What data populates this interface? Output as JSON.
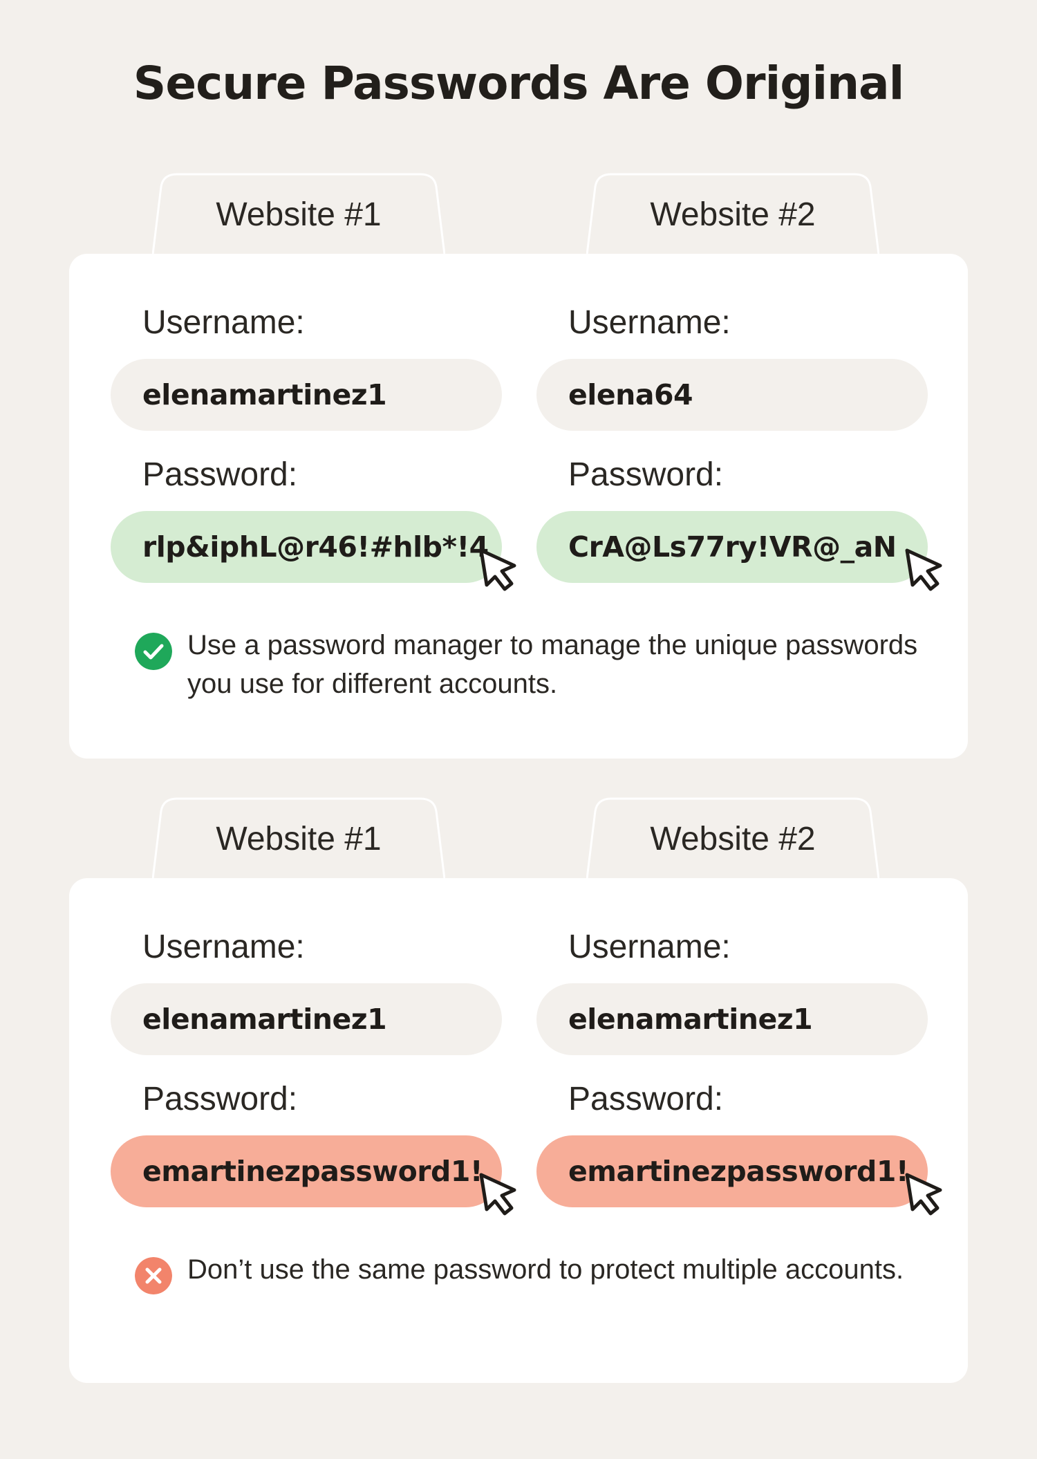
{
  "title": "Secure Passwords Are Original",
  "colors": {
    "background": "#f3f0ec",
    "card": "#ffffff",
    "good_pill": "#d5ecd2",
    "bad_pill": "#f7ad98",
    "good_icon": "#1fa85a",
    "bad_icon": "#f2846b"
  },
  "good_example": {
    "websites": [
      {
        "tab_label": "Website #1",
        "username_label": "Username:",
        "username": "elenamartinez1",
        "password_label": "Password:",
        "password": "rlp&iphL@r46!#hlb*!4",
        "cursor_icon": "pointer-cursor-icon"
      },
      {
        "tab_label": "Website #2",
        "username_label": "Username:",
        "username": "elena64",
        "password_label": "Password:",
        "password": "CrA@Ls77ry!VR@_aN",
        "cursor_icon": "pointer-cursor-icon"
      }
    ],
    "note_icon": "check-circle-icon",
    "note": "Use a password manager to manage the unique passwords you use for different accounts."
  },
  "bad_example": {
    "websites": [
      {
        "tab_label": "Website #1",
        "username_label": "Username:",
        "username": "elenamartinez1",
        "password_label": "Password:",
        "password": "emartinezpassword1!",
        "cursor_icon": "pointer-cursor-icon"
      },
      {
        "tab_label": "Website #2",
        "username_label": "Username:",
        "username": "elenamartinez1",
        "password_label": "Password:",
        "password": "emartinezpassword1!",
        "cursor_icon": "pointer-cursor-icon"
      }
    ],
    "note_icon": "x-circle-icon",
    "note": "Don’t use the same password to protect multiple accounts."
  }
}
